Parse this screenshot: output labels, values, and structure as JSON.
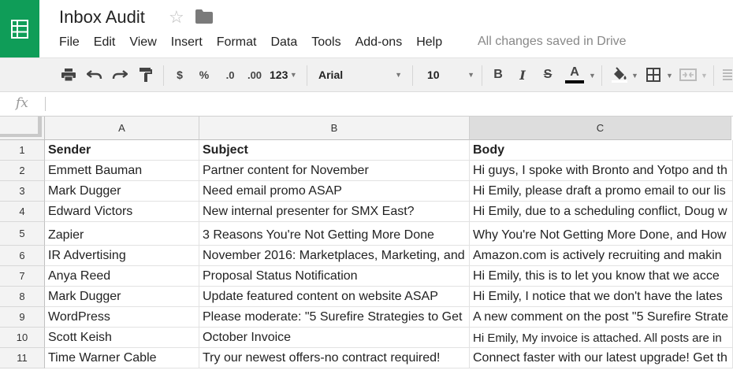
{
  "app": {
    "title": "Inbox Audit",
    "brand_color": "#0f9d58",
    "star_icon": "☆",
    "save_status": "All changes saved in Drive"
  },
  "menu": [
    "File",
    "Edit",
    "View",
    "Insert",
    "Format",
    "Data",
    "Tools",
    "Add-ons",
    "Help"
  ],
  "toolbar": {
    "currency": "$",
    "percent": "%",
    "decrease_decimals": ".0",
    "increase_decimals": ".00",
    "more_formats": "123",
    "font_name": "Arial",
    "font_size": "10",
    "bold": "B",
    "italic": "I",
    "strikethrough": "S",
    "text_color": "A",
    "text_color_value": "#000000",
    "icons": [
      "print-icon",
      "undo-icon",
      "redo-icon",
      "paint-format-icon",
      "fill-color-icon",
      "borders-icon",
      "merge-cells-icon",
      "align-icon"
    ]
  },
  "formula_bar": {
    "label": "fx",
    "value": ""
  },
  "sheet": {
    "columns": [
      "A",
      "B",
      "C"
    ],
    "selected_column": "C",
    "rows": [
      {
        "num": "1",
        "cells": [
          "Sender",
          "Subject",
          "Body"
        ],
        "bold": true
      },
      {
        "num": "2",
        "cells": [
          "Emmett Bauman",
          "Partner content for November",
          "Hi guys, I spoke with Bronto and Yotpo and th"
        ]
      },
      {
        "num": "3",
        "cells": [
          "Mark Dugger",
          "Need email promo ASAP",
          "Hi Emily, please draft a promo email to our lis"
        ]
      },
      {
        "num": "4",
        "cells": [
          "Edward Victors",
          "New internal presenter for SMX East?",
          "Hi Emily, due to a scheduling conflict, Doug w"
        ]
      },
      {
        "num": "5",
        "cells": [
          "Zapier",
          "3 Reasons You're Not Getting More Done",
          "Why You're Not Getting More Done, and How"
        ]
      },
      {
        "num": "6",
        "cells": [
          "IR Advertising",
          "November 2016: Marketplaces, Marketing, and",
          "Amazon.com is actively recruiting and makin"
        ]
      },
      {
        "num": "7",
        "cells": [
          "Anya Reed",
          "Proposal Status Notification",
          "Hi Emily, this is to let you know that we acce"
        ]
      },
      {
        "num": "8",
        "cells": [
          "Mark Dugger",
          "Update featured content on website ASAP",
          "Hi Emily, I notice that we don't have the lates"
        ]
      },
      {
        "num": "9",
        "cells": [
          "WordPress",
          "Please moderate: \"5 Surefire Strategies to Get",
          "A new comment on the post \"5 Surefire Strate"
        ]
      },
      {
        "num": "10",
        "cells": [
          "Scott Keish",
          "October Invoice",
          "Hi Emily,  My invoice is attached. All posts are in"
        ]
      },
      {
        "num": "11",
        "cells": [
          "Time Warner Cable",
          "Try our newest offers-no contract required!",
          "Connect faster with our latest upgrade! Get th"
        ]
      }
    ]
  }
}
